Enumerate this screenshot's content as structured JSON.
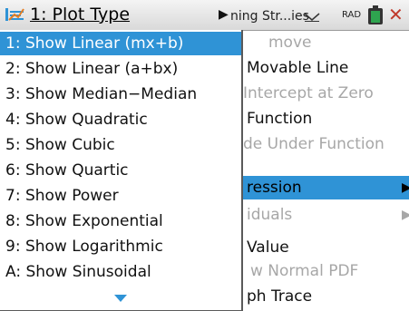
{
  "titlebar": {
    "label": "1: Plot Type",
    "tab": "ning Str...ies",
    "mode": "RAD"
  },
  "background_menu": [
    {
      "label": "move",
      "disabled": true
    },
    {
      "label": "Movable Line",
      "disabled": false
    },
    {
      "label": "Intercept at Zero",
      "disabled": true
    },
    {
      "label": "Function",
      "disabled": false
    },
    {
      "label": "de Under Function",
      "disabled": true
    },
    {
      "label": "ression",
      "disabled": false,
      "selected": true,
      "submenu": true
    },
    {
      "label": "iduals",
      "disabled": true,
      "submenu": true
    },
    {
      "label": "Value",
      "disabled": false
    },
    {
      "label": "w Normal PDF",
      "disabled": true
    },
    {
      "label": "ph Trace",
      "disabled": false
    }
  ],
  "submenu": {
    "items": [
      "1: Show Linear (mx+b)",
      "2: Show Linear (a+bx)",
      "3: Show Median−Median",
      "4: Show Quadratic",
      "5: Show Cubic",
      "6: Show Quartic",
      "7: Show Power",
      "8: Show Exponential",
      "9: Show Logarithmic",
      "A: Show Sinusoidal"
    ],
    "selected_index": 0
  },
  "colors": {
    "highlight": "#2f93d6",
    "disabled_text": "#a7a7a7",
    "scroll_arrow": "#2f93d6",
    "battery": "#2ea44f",
    "close": "#c0392b"
  },
  "icons": [
    "plot-type-icon",
    "submenu-arrow-icon",
    "dropdown-arrow-icon",
    "battery-icon",
    "close-icon",
    "scroll-down-icon"
  ]
}
